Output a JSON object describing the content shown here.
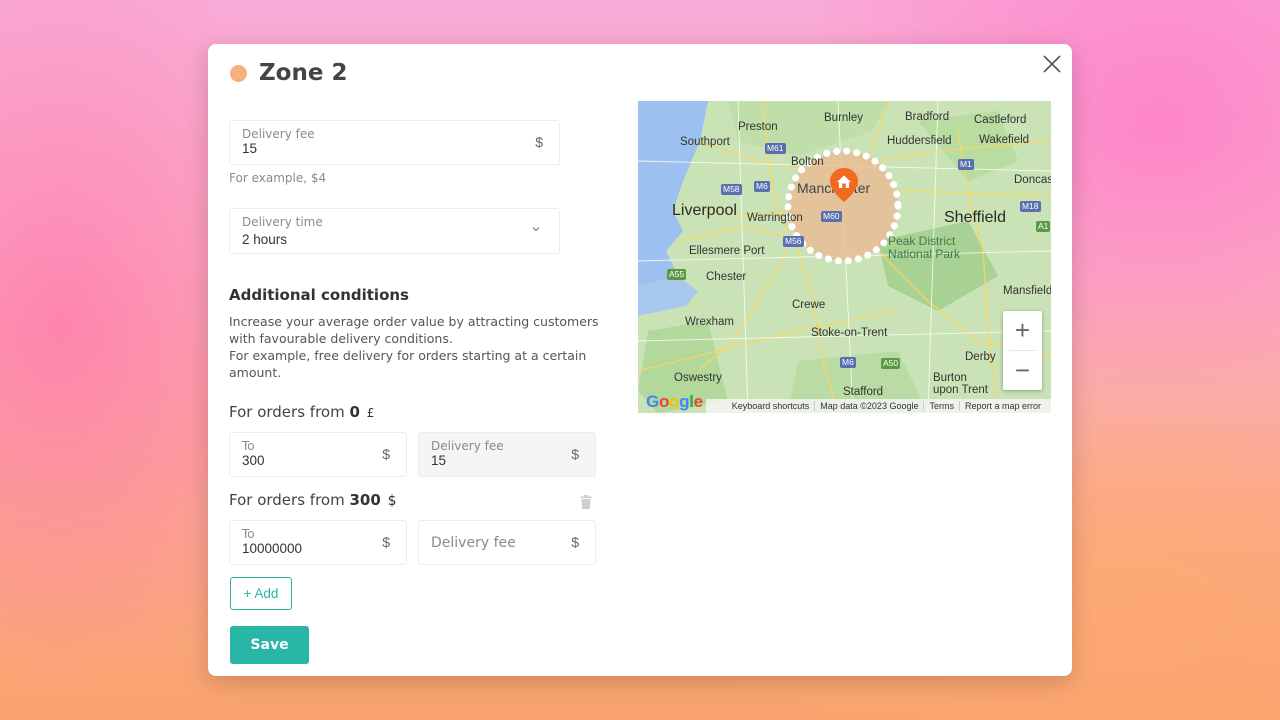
{
  "modal": {
    "title": "Zone 2",
    "zone_color": "#f6b07e",
    "accent_color": "#29b6a6",
    "close_icon": "close-icon"
  },
  "delivery_fee": {
    "label": "Delivery fee",
    "value": "15",
    "suffix": "$",
    "helper": "For example, $4"
  },
  "delivery_time": {
    "label": "Delivery time",
    "value": "2 hours"
  },
  "conditions": {
    "title": "Additional conditions",
    "description_1": "Increase your average order value by attracting customers with favourable delivery conditions.",
    "description_2": "For example, free delivery for orders starting at a certain amount.",
    "tiers": [
      {
        "prefix": "For orders from",
        "from": "0",
        "currency": "£",
        "to_label": "To",
        "to_value": "300",
        "to_suffix": "$",
        "fee_label": "Delivery fee",
        "fee_value": "15",
        "fee_suffix": "$"
      },
      {
        "prefix": "For orders from",
        "from": "300",
        "currency": "$",
        "to_label": "To",
        "to_value": "10000000",
        "to_suffix": "$",
        "fee_placeholder": "Delivery fee",
        "fee_suffix": "$"
      }
    ],
    "add_label": "+ Add",
    "save_label": "Save"
  },
  "map": {
    "places": {
      "preston": "Preston",
      "burnley": "Burnley",
      "bradford": "Bradford",
      "castleford": "Castleford",
      "southport": "Southport",
      "huddersfield": "Huddersfield",
      "wakefield": "Wakefield",
      "bolton": "Bolton",
      "manchester": "Manchester",
      "doncaster": "Doncas",
      "liverpool": "Liverpool",
      "warrington": "Warrington",
      "sheffield": "Sheffield",
      "ellesmere": "Ellesmere Port",
      "peak_district": "Peak District",
      "national_park": "National Park",
      "chester": "Chester",
      "crewe": "Crewe",
      "mansfield": "Mansfield",
      "wrexham": "Wrexham",
      "stoke": "Stoke-on-Trent",
      "derby": "Derby",
      "oswestry": "Oswestry",
      "burton": "Burton",
      "burton2": "upon Trent",
      "stafford": "Stafford"
    },
    "roads": [
      "M61",
      "M6",
      "M58",
      "M60",
      "M1",
      "M18",
      "M56",
      "A55",
      "M6",
      "A50",
      "A1"
    ],
    "zoom_in": "+",
    "zoom_out": "−",
    "logo": "Google",
    "footer": {
      "shortcuts": "Keyboard shortcuts",
      "data": "Map data ©2023 Google",
      "terms": "Terms",
      "report": "Report a map error"
    }
  }
}
